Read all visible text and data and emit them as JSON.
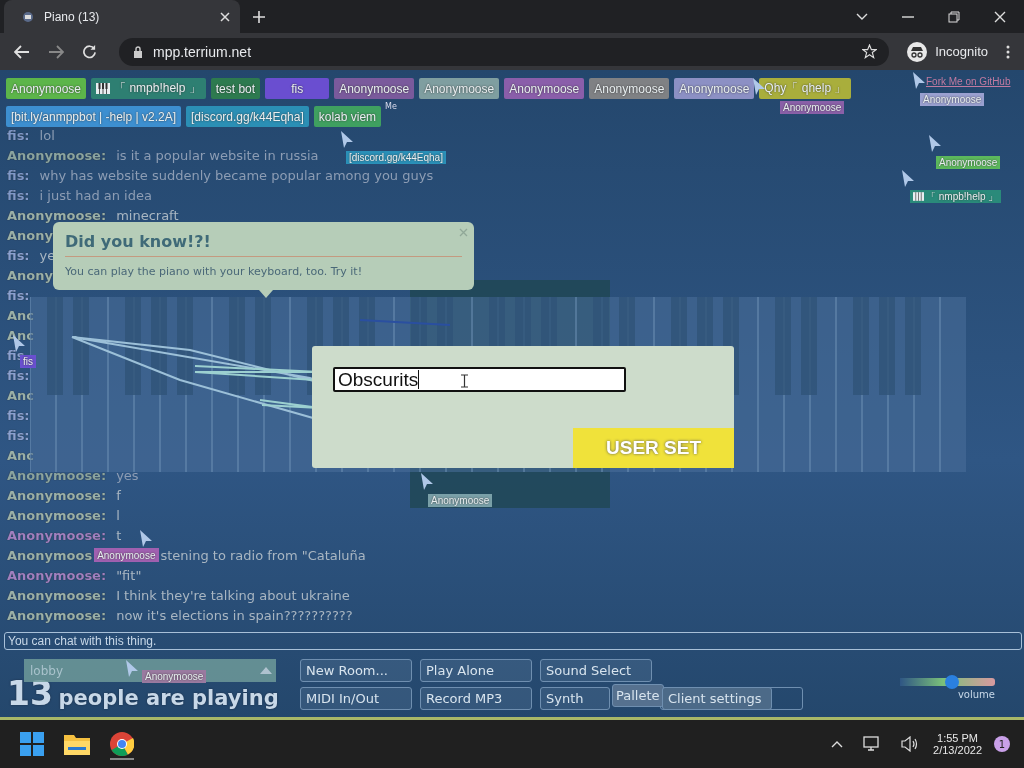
{
  "browser": {
    "tab_title": "Piano (13)",
    "url": "mpp.terrium.net",
    "incognito_label": "Incognito"
  },
  "users": [
    {
      "label": "Anonymoose",
      "color": "#5cb54a",
      "kind": "plain"
    },
    {
      "label": "「 nmpb!help 」",
      "color": "#2e7f72",
      "kind": "keyboard"
    },
    {
      "label": "test bot",
      "color": "#2d7a4f",
      "kind": "plain"
    },
    {
      "label": "fis",
      "color": "#6a4ed0",
      "kind": "plain"
    },
    {
      "label": "Anonymoose",
      "color": "#7a5a9c",
      "kind": "plain"
    },
    {
      "label": "Anonymoose",
      "color": "#7f9ea0",
      "kind": "plain"
    },
    {
      "label": "Anonymoose",
      "color": "#8a5eaa",
      "kind": "plain"
    },
    {
      "label": "Anonymoose",
      "color": "#7f8184",
      "kind": "plain"
    },
    {
      "label": "Anonymoose",
      "color": "#8c90c4",
      "kind": "plain"
    },
    {
      "label": "Qhy「 qhelp 」",
      "color": "#a9ae3c",
      "kind": "plain"
    },
    {
      "label": "[bit.ly/anmppbot | -help | v2.2A]",
      "color": "#3d8fd0",
      "kind": "plain"
    },
    {
      "label": "[discord.gg/k44Eqha]",
      "color": "#2b8fb5",
      "kind": "plain"
    },
    {
      "label": "kolab viem",
      "color": "#3fa060",
      "kind": "plain"
    }
  ],
  "me_label": "Me",
  "github_link": "Fork Me on GitHub",
  "chat": [
    {
      "name": "fis:",
      "text": "lol",
      "color": "#7f98c8",
      "faded": true
    },
    {
      "name": "Anonymoose:",
      "text": "is it a popular website in russia",
      "color": "#8aa4a0",
      "faded": true
    },
    {
      "name": "fis:",
      "text": "why has website suddenly became popular among you guys",
      "color": "#7f98c8",
      "faded": true
    },
    {
      "name": "fis:",
      "text": "i just had an idea",
      "color": "#7f98c8",
      "faded": true
    },
    {
      "name": "Anonymoose:",
      "text": "minecraft",
      "color": "#9ab0a8",
      "faded": false
    },
    {
      "name": "Anony",
      "color": "#9ab0a8"
    },
    {
      "name": "fis:",
      "text": "ye",
      "color": "#8aa0d0",
      "faded": false
    },
    {
      "name": "Anony",
      "color": "#9ab0a8"
    },
    {
      "name": "fis:",
      "color": "#8aa0d0"
    },
    {
      "name": "Anc",
      "color": "#9ab0a8"
    },
    {
      "name": "Anc",
      "color": "#9ab0a8"
    },
    {
      "name": "fis",
      "color": "#8aa0d0"
    },
    {
      "name": "fis:",
      "color": "#8aa0d0"
    },
    {
      "name": "Anc",
      "color": "#9ab0a8"
    },
    {
      "name": "fis:",
      "color": "#8aa0d0"
    },
    {
      "name": "fis:",
      "color": "#8aa0d0"
    },
    {
      "name": "Anc",
      "color": "#9ab0a8"
    },
    {
      "name": "Anonymoose:",
      "text": "yes",
      "color": "#8aa4a0",
      "faded": true
    },
    {
      "name": "Anonymoose:",
      "text": "f",
      "color": "#9ab0a8",
      "faded": false
    },
    {
      "name": "Anonymoose:",
      "text": "l",
      "color": "#9ab0a8",
      "faded": false
    },
    {
      "name": "Anonymoose:",
      "text": "t",
      "color": "#a080c0",
      "faded": false
    },
    {
      "name": "Anonymoos",
      "overlay_label": {
        "label": "Anonymoose",
        "color": "#a060b0"
      },
      "text": "stening to radio from \"Cataluña",
      "color": "#9ab0a8",
      "faded": false
    },
    {
      "name": "Anonymoose:",
      "text": "\"fit\"",
      "color": "#a080c0",
      "faded": false
    },
    {
      "name": "Anonymoose:",
      "text": "I think they're talking about ukraine",
      "color": "#9ab0a8",
      "faded": false
    },
    {
      "name": "Anonymoose:",
      "text": "now it's elections in spain??????????",
      "color": "#9ab0a8",
      "faded": false
    }
  ],
  "cursors": [
    {
      "label": "Anonymoose",
      "color": "#8a60a8",
      "kind": "plain"
    },
    {
      "label": "Anonymoose",
      "color": "#9aa0d0",
      "kind": "plain"
    },
    {
      "label": "Anonymoose",
      "color": "#5cb85c",
      "kind": "plain"
    },
    {
      "label": "「 nmpb!help 」",
      "color": "#2a8a7a",
      "kind": "keyboard"
    },
    {
      "label": "[discord.gg/k44Eqha]",
      "color": "#2a90b8",
      "kind": "plain"
    },
    {
      "label": "fis",
      "color": "#6a50d0",
      "kind": "plain"
    },
    {
      "label": "Anonymoose",
      "color": "#7aa0a8",
      "kind": "plain"
    },
    {
      "kind": "none"
    },
    {
      "label": "Anonymoose",
      "color": "#9a7aa0",
      "kind": "plain"
    }
  ],
  "tip": {
    "title": "Did you know!?!",
    "text": "You can play the piano with your keyboard, too. Try it!"
  },
  "dialog": {
    "value": "Obscurits",
    "button": "USER SET"
  },
  "chat_input": {
    "placeholder": "You can chat with this thing."
  },
  "room": {
    "value": "lobby"
  },
  "player_count": "13",
  "player_text": "people are playing",
  "buttons": [
    "New Room...",
    "Play Alone",
    "Sound Select",
    "MIDI In/Out",
    "Record MP3",
    "Synth"
  ],
  "pallete": "Pallete",
  "client_settings": "Client settings",
  "volume": {
    "level": 0.55,
    "label": "volume"
  },
  "taskbar": {
    "time": "1:55 PM",
    "date": "2/13/2022",
    "notifications": "1"
  }
}
